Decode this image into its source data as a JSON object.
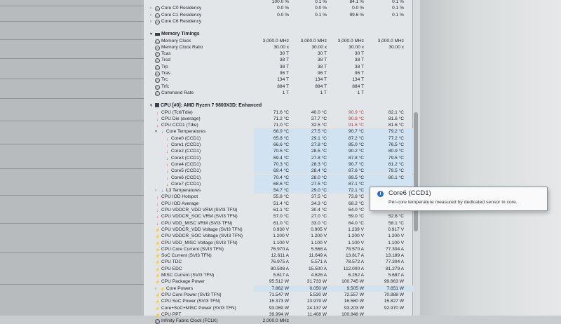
{
  "groups": [
    {
      "rows": [
        {
          "name": "",
          "icon": "none",
          "values": [
            "100.0 %",
            "0.1 %",
            "84.1 %",
            "0.1 %"
          ]
        },
        {
          "name": "Core C0 Residency",
          "icon": "clock",
          "tw": "›",
          "values": [
            "0.0 %",
            "0.0 %",
            "0.0 %",
            "0.1 %"
          ]
        },
        {
          "name": "Core C1 Residency",
          "icon": "clock",
          "tw": "›",
          "values": [
            "0.0 %",
            "0.1 %",
            "99.6 %",
            "0.1 %"
          ]
        },
        {
          "name": "Core C6 Residency",
          "icon": "clock",
          "tw": "›",
          "values": [
            "",
            "",
            "",
            ""
          ]
        }
      ]
    },
    {
      "rows": [
        {
          "name": "Memory Timings",
          "icon": "mem",
          "tw": "▾",
          "section": true,
          "values": [
            "",
            "",
            "",
            ""
          ]
        },
        {
          "name": "Memory Clock",
          "icon": "clock",
          "values": [
            "3,000.0 MHz",
            "3,000.0 MHz",
            "3,000.0 MHz",
            "3,000.0 MHz"
          ]
        },
        {
          "name": "Memory Clock Ratio",
          "icon": "clock",
          "values": [
            "30.00 x",
            "30.00 x",
            "30.00 x",
            "30.00 x"
          ]
        },
        {
          "name": "Tcas",
          "icon": "clock",
          "values": [
            "30 T",
            "30 T",
            "30 T",
            ""
          ]
        },
        {
          "name": "Trcd",
          "icon": "clock",
          "values": [
            "38 T",
            "38 T",
            "38 T",
            ""
          ]
        },
        {
          "name": "Trp",
          "icon": "clock",
          "values": [
            "38 T",
            "38 T",
            "38 T",
            ""
          ]
        },
        {
          "name": "Tras",
          "icon": "clock",
          "values": [
            "96 T",
            "96 T",
            "96 T",
            ""
          ]
        },
        {
          "name": "Trc",
          "icon": "clock",
          "values": [
            "134 T",
            "134 T",
            "134 T",
            ""
          ]
        },
        {
          "name": "Trfc",
          "icon": "clock",
          "values": [
            "884 T",
            "884 T",
            "884 T",
            ""
          ]
        },
        {
          "name": "Command Rate",
          "icon": "clock",
          "values": [
            "1 T",
            "1 T",
            "1 T",
            ""
          ]
        }
      ]
    },
    {
      "rows": [
        {
          "name": "CPU [#0]: AMD Ryzen 7 9800X3D: Enhanced",
          "icon": "chip",
          "tw": "▾",
          "section": true,
          "values": [
            "",
            "",
            "",
            ""
          ]
        },
        {
          "name": "CPU (Tctl/Tdie)",
          "icon": "therm",
          "values": [
            "71.6 °C",
            "40.0 °C",
            "90.9 °C",
            "82.1 °C"
          ],
          "red": 2
        },
        {
          "name": "CPU Die (average)",
          "icon": "therm",
          "values": [
            "71.2 °C",
            "37.7 °C",
            "90.8 °C",
            "81.6 °C"
          ],
          "red": 2
        },
        {
          "name": "CPU CCD1 (Tdie)",
          "icon": "therm",
          "values": [
            "71.0 °C",
            "32.5 °C",
            "91.6 °C",
            "81.6 °C"
          ],
          "red": 2
        },
        {
          "name": "Core Temperatures",
          "icon": "therm",
          "tw": "▾",
          "indent": 1,
          "values": [
            "68.9 °C",
            "27.5 °C",
            "90.7 °C",
            "79.2 °C"
          ]
        },
        {
          "name": "Core0 (CCD1)",
          "icon": "therm",
          "indent": 2,
          "values": [
            "65.8 °C",
            "29.1 °C",
            "87.2 °C",
            "77.2 °C"
          ]
        },
        {
          "name": "Core1 (CCD1)",
          "icon": "therm",
          "indent": 2,
          "values": [
            "66.6 °C",
            "27.8 °C",
            "85.0 °C",
            "76.5 °C"
          ]
        },
        {
          "name": "Core2 (CCD1)",
          "icon": "therm",
          "indent": 2,
          "values": [
            "70.5 °C",
            "28.5 °C",
            "90.2 °C",
            "80.9 °C"
          ]
        },
        {
          "name": "Core3 (CCD1)",
          "icon": "therm",
          "indent": 2,
          "values": [
            "69.4 °C",
            "27.8 °C",
            "87.8 °C",
            "79.5 °C"
          ]
        },
        {
          "name": "Core4 (CCD1)",
          "icon": "therm",
          "indent": 2,
          "values": [
            "70.3 °C",
            "28.3 °C",
            "90.7 °C",
            "81.2 °C"
          ]
        },
        {
          "name": "Core5 (CCD1)",
          "icon": "therm",
          "indent": 2,
          "values": [
            "69.4 °C",
            "28.4 °C",
            "87.6 °C",
            "79.5 °C"
          ]
        },
        {
          "name": "Core6 (CCD1)",
          "icon": "therm",
          "indent": 2,
          "values": [
            "70.4 °C",
            "28.0 °C",
            "89.5 °C",
            "80.1 °C"
          ]
        },
        {
          "name": "Core7 (CCD1)",
          "icon": "therm",
          "indent": 2,
          "values": [
            "68.6 °C",
            "27.5 °C",
            "87.1 °C",
            ""
          ]
        },
        {
          "name": "L3 Temperatures",
          "icon": "therm",
          "tw": "›",
          "indent": 1,
          "values": [
            "54.7 °C",
            "29.0 °C",
            "72.1 °C",
            ""
          ]
        },
        {
          "name": "CPU IOD Hotspot",
          "icon": "therm",
          "values": [
            "55.8 °C",
            "37.5 °C",
            "73.8 °C",
            ""
          ]
        },
        {
          "name": "CPU IOD Average",
          "icon": "therm",
          "values": [
            "51.4 °C",
            "34.3 °C",
            "68.2 °C",
            "61.2 °C"
          ]
        },
        {
          "name": "CPU VDDCR_VDD VRM (SVI3 TFN)",
          "icon": "therm",
          "values": [
            "61.1 °C",
            "30.4 °C",
            "64.0 °C",
            "57.6 °C"
          ]
        },
        {
          "name": "CPU VDDCR_SOC VRM (SVI3 TFN)",
          "icon": "therm",
          "values": [
            "57.0 °C",
            "27.0 °C",
            "59.0 °C",
            "52.8 °C"
          ]
        },
        {
          "name": "CPU VDD_MISC VRM (SVI3 TFN)",
          "icon": "therm",
          "values": [
            "61.0 °C",
            "33.0 °C",
            "64.0 °C",
            "58.1 °C"
          ]
        },
        {
          "name": "CPU VDDCR_VDD Voltage (SVI3 TFN)",
          "icon": "volt",
          "values": [
            "0.930 V",
            "0.905 V",
            "1.239 V",
            "0.917 V"
          ]
        },
        {
          "name": "CPU VDDCR_SOC Voltage (SVI3 TFN)",
          "icon": "volt",
          "values": [
            "1.200 V",
            "1.200 V",
            "1.200 V",
            "1.200 V"
          ]
        },
        {
          "name": "CPU VDD_MISC Voltage (SVI3 TFN)",
          "icon": "volt",
          "values": [
            "1.100 V",
            "1.100 V",
            "1.100 V",
            "1.100 V"
          ]
        },
        {
          "name": "CPU Core Current (SVI3 TFN)",
          "icon": "volt",
          "values": [
            "76.970 A",
            "5.568 A",
            "78.570 A",
            "77.304 A"
          ]
        },
        {
          "name": "SoC Current (SVI3 TFN)",
          "icon": "volt",
          "values": [
            "12.611 A",
            "11.649 A",
            "13.817 A",
            "13.189 A"
          ]
        },
        {
          "name": "CPU TDC",
          "icon": "volt",
          "values": [
            "76.975 A",
            "5.571 A",
            "78.572 A",
            "77.304 A"
          ]
        },
        {
          "name": "CPU EDC",
          "icon": "volt",
          "values": [
            "80.508 A",
            "15.500 A",
            "112.000 A",
            "81.279 A"
          ]
        },
        {
          "name": "MISC Current (SVI3 TFN)",
          "icon": "volt",
          "values": [
            "5.617 A",
            "4.626 A",
            "6.252 A",
            "5.687 A"
          ]
        },
        {
          "name": "CPU Package Power",
          "icon": "volt",
          "values": [
            "95.512 W",
            "31.733 W",
            "100.745 W",
            "99.863 W"
          ]
        },
        {
          "name": "Core Powers",
          "icon": "volt",
          "tw": "›",
          "indent": 1,
          "values": [
            "7.862 W",
            "0.050 W",
            "9.505 W",
            "7.651 W"
          ]
        },
        {
          "name": "CPU Core Power (SVI3 TFN)",
          "icon": "volt",
          "values": [
            "71.547 W",
            "5.530 W",
            "72.557 W",
            "70.888 W"
          ]
        },
        {
          "name": "CPU SoC Power (SVI3 TFN)",
          "icon": "volt",
          "values": [
            "15.373 W",
            "13.979 W",
            "16.580 W",
            "15.827 W"
          ]
        },
        {
          "name": "Core+SoC+MISC Power (SVI3 TFN)",
          "icon": "volt",
          "values": [
            "93.089 W",
            "24.137 W",
            "93.203 W",
            "92.970 W"
          ]
        },
        {
          "name": "CPU PPT",
          "icon": "volt",
          "values": [
            "39.994 W",
            "11.408 W",
            "100.848 W",
            ""
          ]
        },
        {
          "name": "Infinity Fabric Clock (FCLK)",
          "icon": "clock",
          "values": [
            "2,000.0 MHz",
            "",
            "",
            ""
          ]
        }
      ]
    }
  ],
  "tooltip": {
    "title": "Core6 (CCD1)",
    "description": "Per-core temperature measured by dedicated sensor in core.",
    "icon": "info-icon"
  }
}
